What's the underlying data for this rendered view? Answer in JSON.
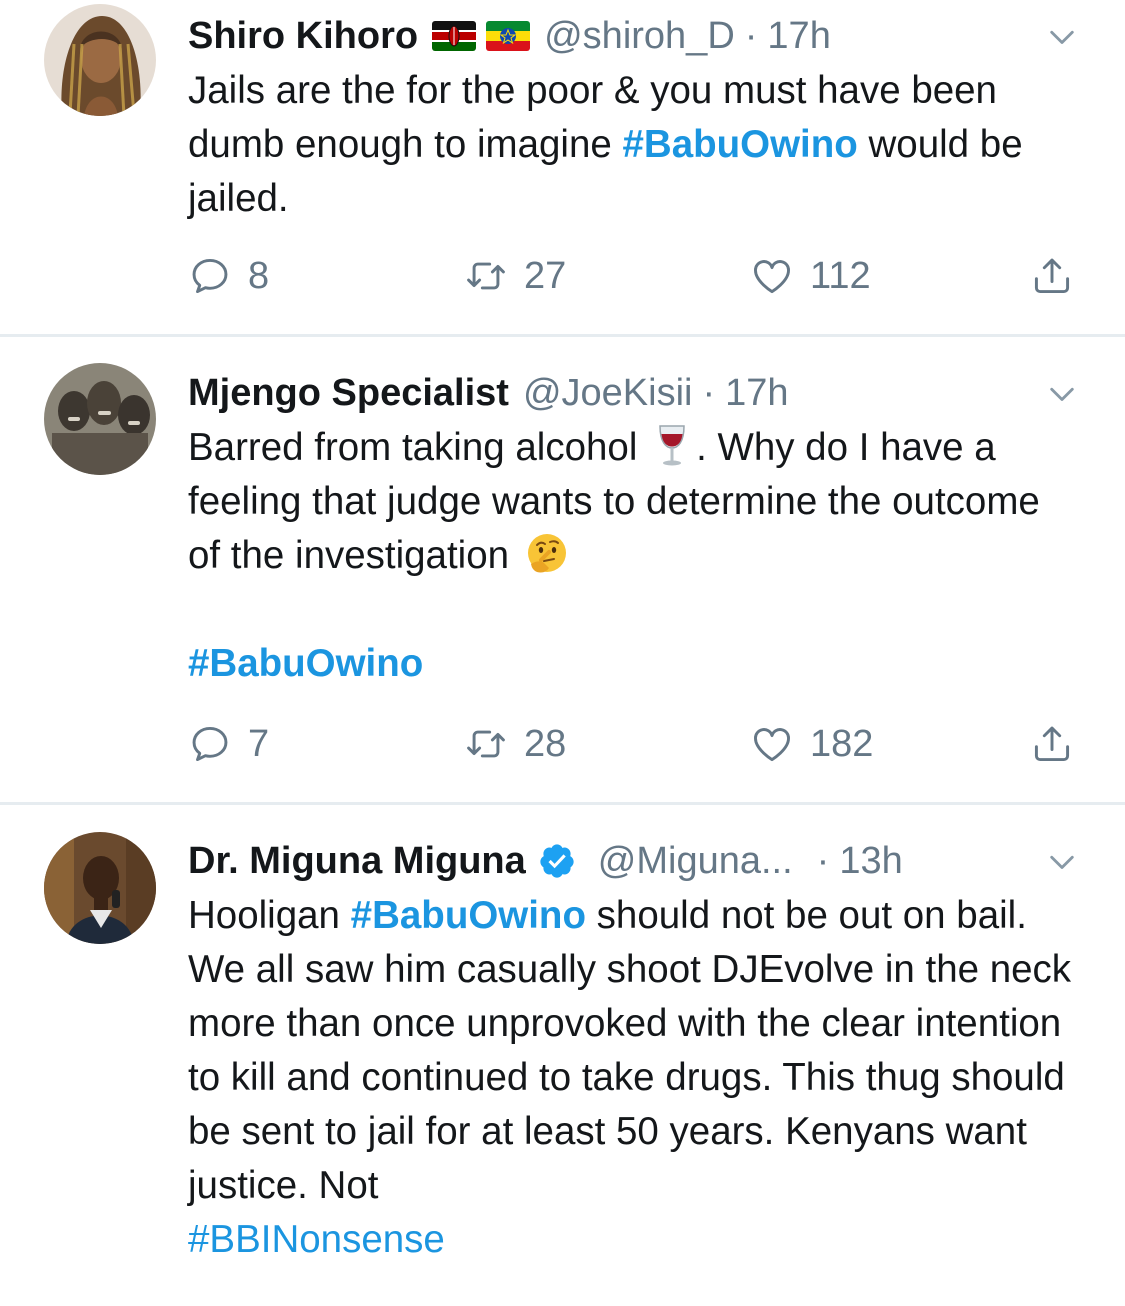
{
  "tweets": [
    {
      "name": "Shiro Kihoro",
      "handle": "@shiroh_D",
      "separator": "·",
      "time": "17h",
      "text_parts": [
        {
          "text": "Jails are the for the poor & you must have been dumb enough to imagine "
        },
        {
          "text": "#BabuOwino",
          "tag": true
        },
        {
          "text": " would be jailed."
        }
      ],
      "replies": "8",
      "retweets": "27",
      "likes": "112",
      "flags": [
        "kenya-flag",
        "ethiopia-flag"
      ]
    },
    {
      "name": "Mjengo Specialist",
      "handle": "@JoeKisii",
      "separator": "·",
      "time": "17h",
      "text_a": "Barred from taking alcohol",
      "emoji_a": "wine-glass-emoji",
      "text_b": ". Why do I have a feeling that judge wants to determine the outcome of the investigation",
      "emoji_b": "thinking-face-emoji",
      "hashtag": "#BabuOwino",
      "replies": "7",
      "retweets": "28",
      "likes": "182"
    },
    {
      "name": "Dr. Miguna Miguna",
      "handle": "@Miguna...",
      "separator": "·",
      "time": "13h",
      "verified": true,
      "text_pre": "Hooligan ",
      "hashtag": "#BabuOwino",
      "text_post": " should not be out on bail. We all saw him casually shoot DJEvolve in the neck more than once unprovoked with the clear intention to kill and continued to take drugs. This thug should be sent to jail for at least 50 years. Kenyans want justice. Not",
      "hashtag2": "#BBINonsense"
    }
  ],
  "colors": {
    "link": "#1b95e0",
    "secondary": "#657786",
    "divider": "#e6ecf0",
    "text": "#14171a"
  },
  "icons": [
    "reply-icon",
    "retweet-icon",
    "like-icon",
    "share-icon",
    "chevron-down-icon",
    "verified-icon"
  ]
}
